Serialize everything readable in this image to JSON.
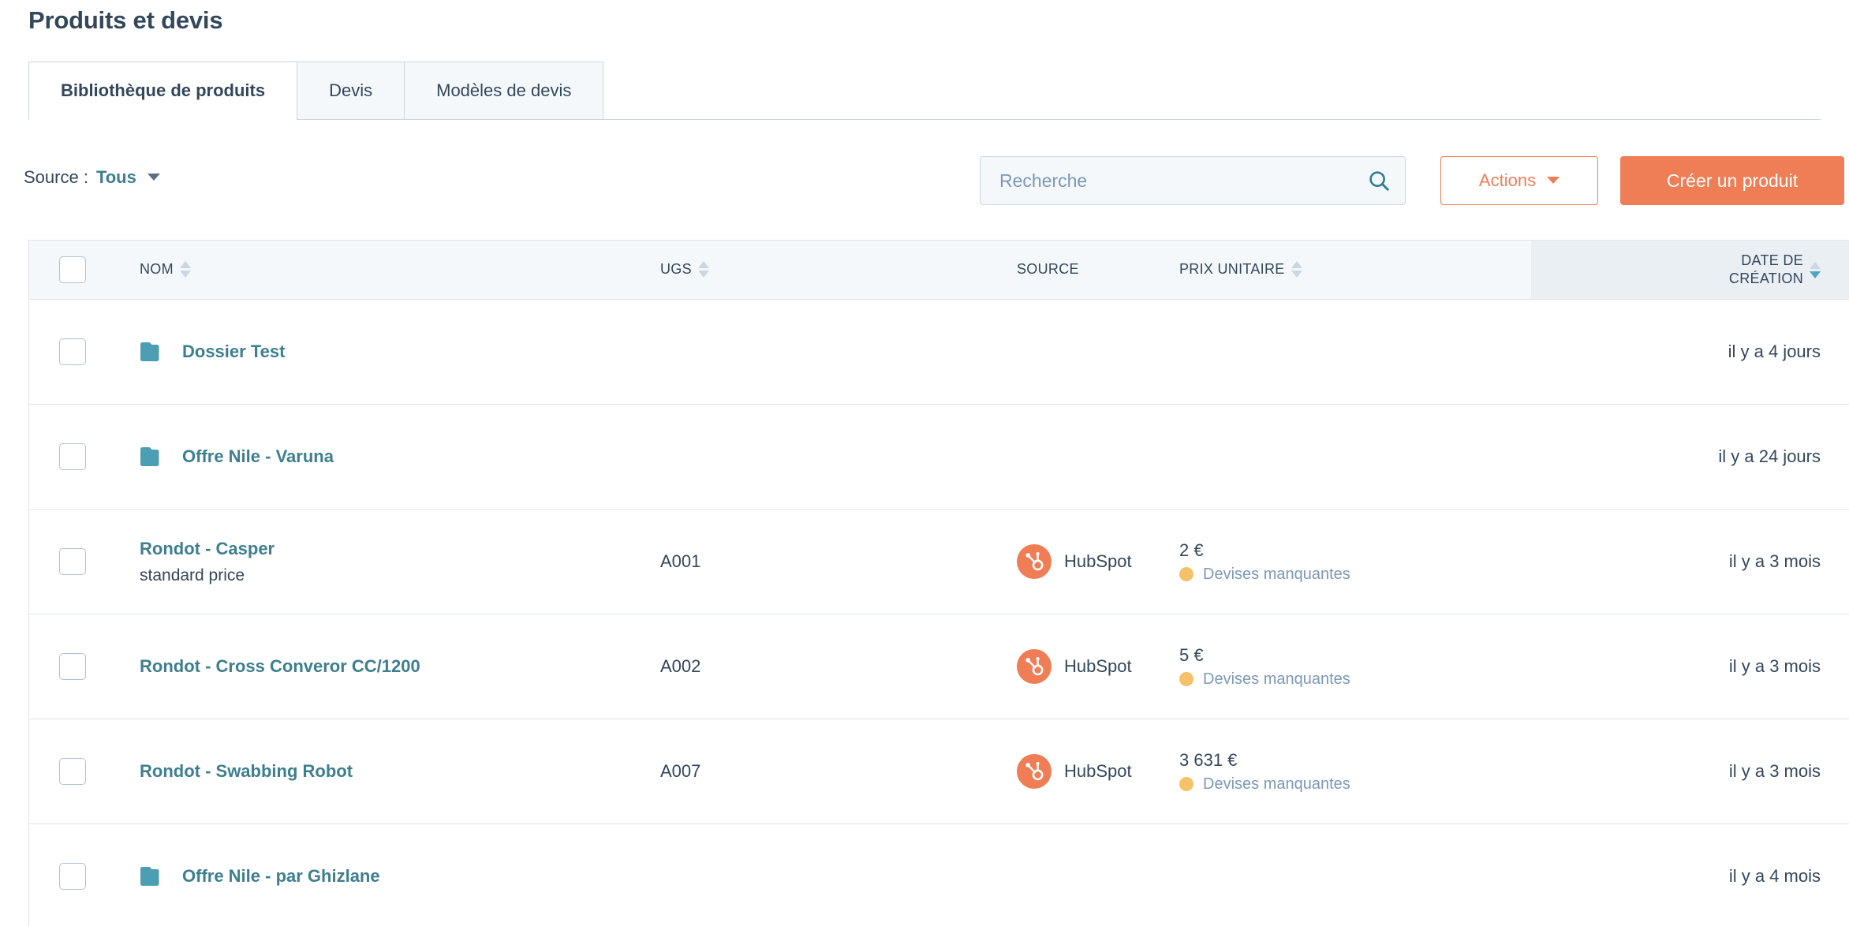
{
  "page": {
    "title": "Produits et devis"
  },
  "tabs": [
    {
      "label": "Bibliothèque de produits",
      "active": true
    },
    {
      "label": "Devis",
      "active": false
    },
    {
      "label": "Modèles de devis",
      "active": false
    }
  ],
  "toolbar": {
    "source_label": "Source :",
    "source_value": "Tous",
    "search_placeholder": "Recherche",
    "search_value": "",
    "search_icon": "search-icon",
    "actions_label": "Actions",
    "create_label": "Créer un produit"
  },
  "table": {
    "columns": [
      {
        "key": "nom",
        "label": "NOM",
        "sortable": true,
        "sort": "none"
      },
      {
        "key": "ugs",
        "label": "UGS",
        "sortable": true,
        "sort": "none"
      },
      {
        "key": "src",
        "label": "SOURCE",
        "sortable": false,
        "sort": "none"
      },
      {
        "key": "price",
        "label": "PRIX UNITAIRE",
        "sortable": true,
        "sort": "none"
      },
      {
        "key": "date",
        "label": "DATE DE\nCRÉATION",
        "sortable": true,
        "sort": "desc"
      }
    ],
    "rows": [
      {
        "type": "folder",
        "name": "Dossier Test",
        "subtext": "",
        "ugs": "",
        "source": "",
        "price": "",
        "price_warning": "",
        "date": "il y a 4 jours"
      },
      {
        "type": "folder",
        "name": "Offre Nile - Varuna",
        "subtext": "",
        "ugs": "",
        "source": "",
        "price": "",
        "price_warning": "",
        "date": "il y a 24 jours"
      },
      {
        "type": "product",
        "name": "Rondot - Casper",
        "subtext": "standard price",
        "ugs": "A001",
        "source": "HubSpot",
        "price": "2 €",
        "price_warning": "Devises manquantes",
        "date": "il y a 3 mois"
      },
      {
        "type": "product",
        "name": "Rondot - Cross Converor CC/1200",
        "subtext": "",
        "ugs": "A002",
        "source": "HubSpot",
        "price": "5 €",
        "price_warning": "Devises manquantes",
        "date": "il y a 3 mois"
      },
      {
        "type": "product",
        "name": "Rondot - Swabbing Robot",
        "subtext": "",
        "ugs": "A007",
        "source": "HubSpot",
        "price": "3 631 €",
        "price_warning": "Devises manquantes",
        "date": "il y a 3 mois"
      },
      {
        "type": "folder",
        "name": "Offre Nile - par Ghizlane",
        "subtext": "",
        "ugs": "",
        "source": "",
        "price": "",
        "price_warning": "",
        "date": "il y a 4 mois"
      }
    ]
  },
  "colors": {
    "accent_orange": "#ef7e56",
    "link_teal": "#3d7f8e",
    "folder_teal": "#4c9fb3",
    "text_dark": "#33475b",
    "warn_amber": "#f5c26b",
    "border": "#dfe3eb"
  }
}
